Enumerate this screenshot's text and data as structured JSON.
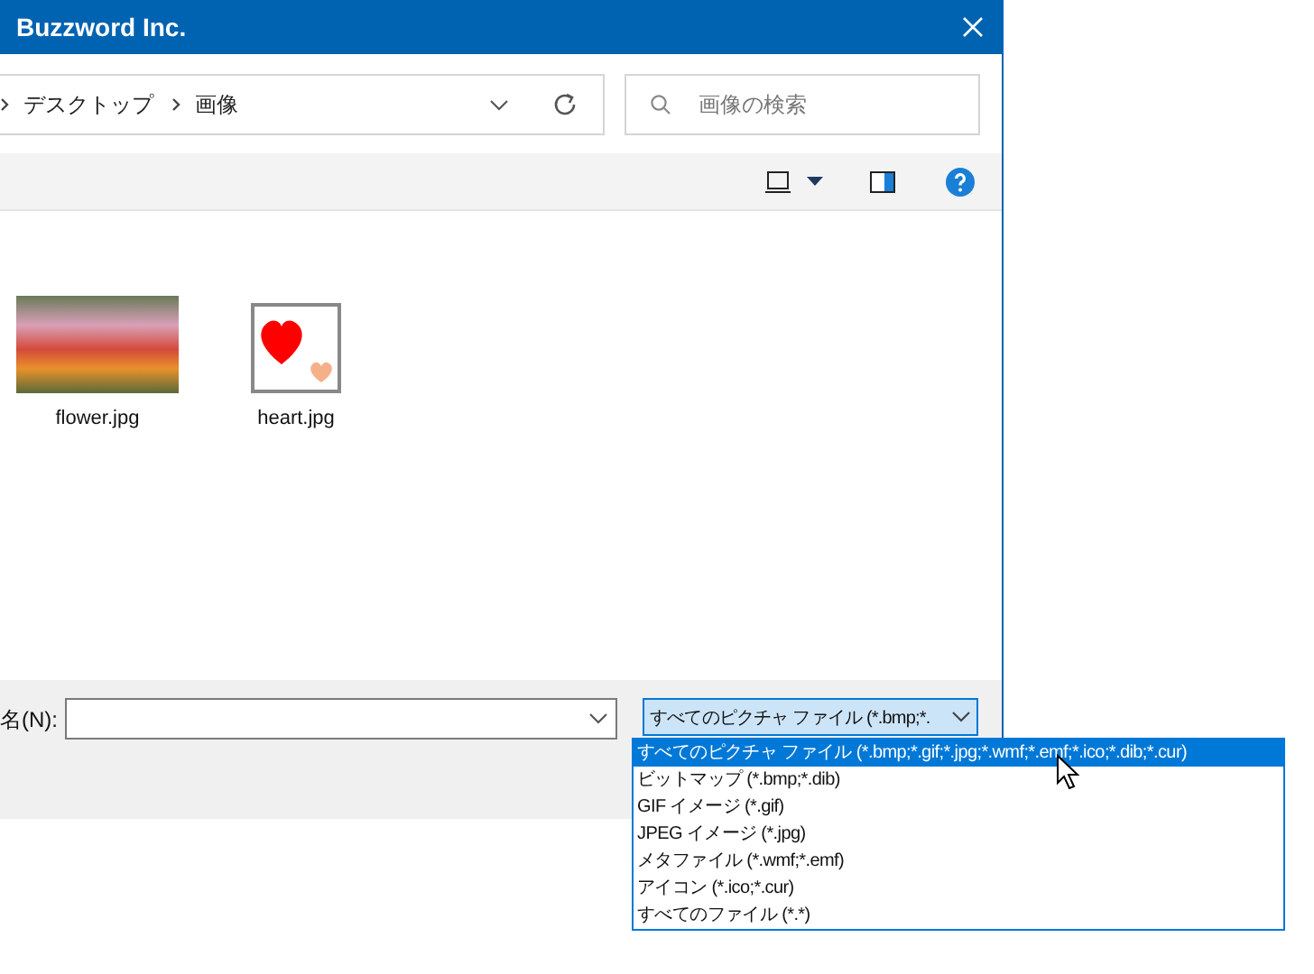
{
  "window": {
    "title": "Buzzword Inc."
  },
  "address": {
    "breadcrumbs": [
      {
        "label": "デスクトップ"
      },
      {
        "label": "画像"
      }
    ]
  },
  "search": {
    "placeholder": "画像の検索"
  },
  "files": [
    {
      "name": "flower.jpg",
      "kind": "photo"
    },
    {
      "name": "heart.jpg",
      "kind": "heart"
    }
  ],
  "filename": {
    "label": "名(N):"
  },
  "file_type": {
    "value": "すべてのピクチャ ファイル (*.bmp;*.",
    "expanded": true,
    "options": [
      {
        "label": "すべてのピクチャ ファイル (*.bmp;*.gif;*.jpg;*.wmf;*.emf;*.ico;*.dib;*.cur)",
        "selected": true
      },
      {
        "label": "ビットマップ (*.bmp;*.dib)",
        "selected": false
      },
      {
        "label": "GIF イメージ (*.gif)",
        "selected": false
      },
      {
        "label": "JPEG イメージ (*.jpg)",
        "selected": false
      },
      {
        "label": "メタファイル (*.wmf;*.emf)",
        "selected": false
      },
      {
        "label": "アイコン (*.ico;*.cur)",
        "selected": false
      },
      {
        "label": "すべてのファイル (*.*)",
        "selected": false
      }
    ]
  }
}
